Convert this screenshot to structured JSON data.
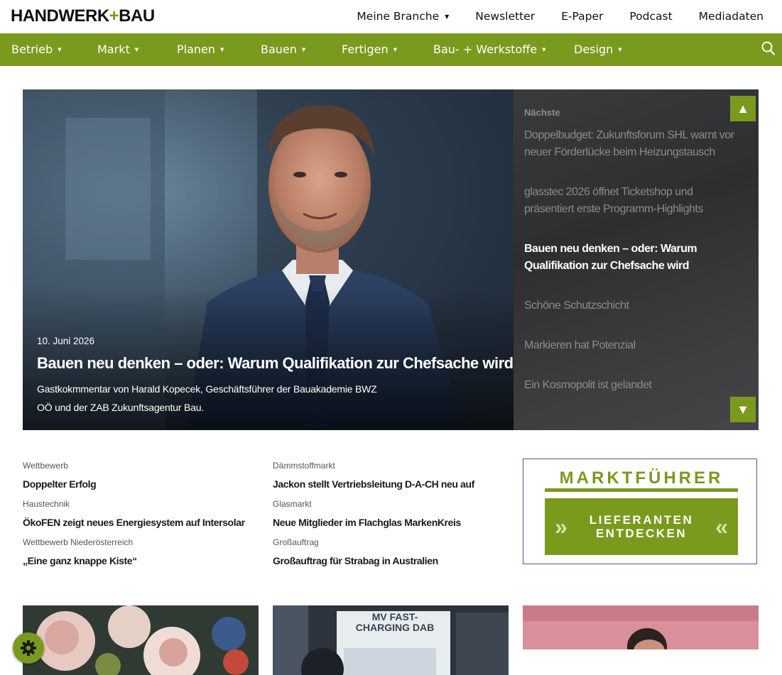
{
  "brand": {
    "logo_left": "HANDWERK",
    "logo_plus": "+",
    "logo_right": "BAU",
    "accent": "#7a9a1e"
  },
  "topnav": [
    {
      "label": "Meine Branche",
      "dropdown": true
    },
    {
      "label": "Newsletter",
      "dropdown": false
    },
    {
      "label": "E-Paper",
      "dropdown": false
    },
    {
      "label": "Podcast",
      "dropdown": false
    },
    {
      "label": "Mediadaten",
      "dropdown": false
    }
  ],
  "mainnav": [
    {
      "label": "Betrieb"
    },
    {
      "label": "Markt"
    },
    {
      "label": "Planen"
    },
    {
      "label": "Bauen"
    },
    {
      "label": "Fertigen"
    },
    {
      "label": "Bau- + Werkstoffe"
    },
    {
      "label": "Design"
    }
  ],
  "mainnav_icons": {
    "search": "search-icon",
    "caret": "caret-down-icon"
  },
  "hero": {
    "date": "10. Juni 2026",
    "title": "Bauen neu denken – oder: Warum Qualifikation zur Chefsache wird",
    "subtitle": "Gastkokmmentar von Harald Kopecek, Geschäftsführer der Bauakademie BWZ OÖ und der ZAB Zukunftsagentur Bau.",
    "side_label": "Nächste",
    "side_items": [
      {
        "label": "Doppelbudget: Zukunftsforum SHL warnt vor neuer Förderlücke beim Heizungstausch",
        "active": false
      },
      {
        "label": "glasstec 2026 öffnet Ticketshop und präsentiert erste Programm-Highlights",
        "active": false
      },
      {
        "label": "Bauen neu denken – oder: Warum Qualifikation zur Chefsache wird",
        "active": true
      },
      {
        "label": "Schöne Schutzschicht",
        "active": false
      },
      {
        "label": "Markieren hat Potenzial",
        "active": false
      },
      {
        "label": "Ein Kosmopolit ist gelandet",
        "active": false
      }
    ],
    "arrow_up": "▲",
    "arrow_down": "▼"
  },
  "news_left": [
    {
      "category": "Wettbewerb",
      "title": "Doppelter Erfolg"
    },
    {
      "category": "Haustechnik",
      "title": "ÖkoFEN zeigt neues Energiesystem auf Intersolar"
    },
    {
      "category": "Wettbewerb Niederösterreich",
      "title": "„Eine ganz knappe Kiste“"
    }
  ],
  "news_right": [
    {
      "category": "Dämmstoffmarkt",
      "title": "Jackon stellt Vertriebsleitung D-A-CH neu auf"
    },
    {
      "category": "Glasmarkt",
      "title": "Neue Mitglieder im Flachglas MarkenKreis"
    },
    {
      "category": "Großauftrag",
      "title": "Großauftrag für Strabag in Australien"
    }
  ],
  "ad": {
    "title": "MARKTFÜHRER",
    "line1": "LIEFERANTEN",
    "line2": "ENTDECKEN",
    "chev_left": "»",
    "chev_right": "«"
  },
  "thumbs": {
    "middle_caption_line1": "MV FAST-",
    "middle_caption_line2": "CHARGING DAB"
  },
  "cookie": {
    "icon": "gear-icon"
  }
}
